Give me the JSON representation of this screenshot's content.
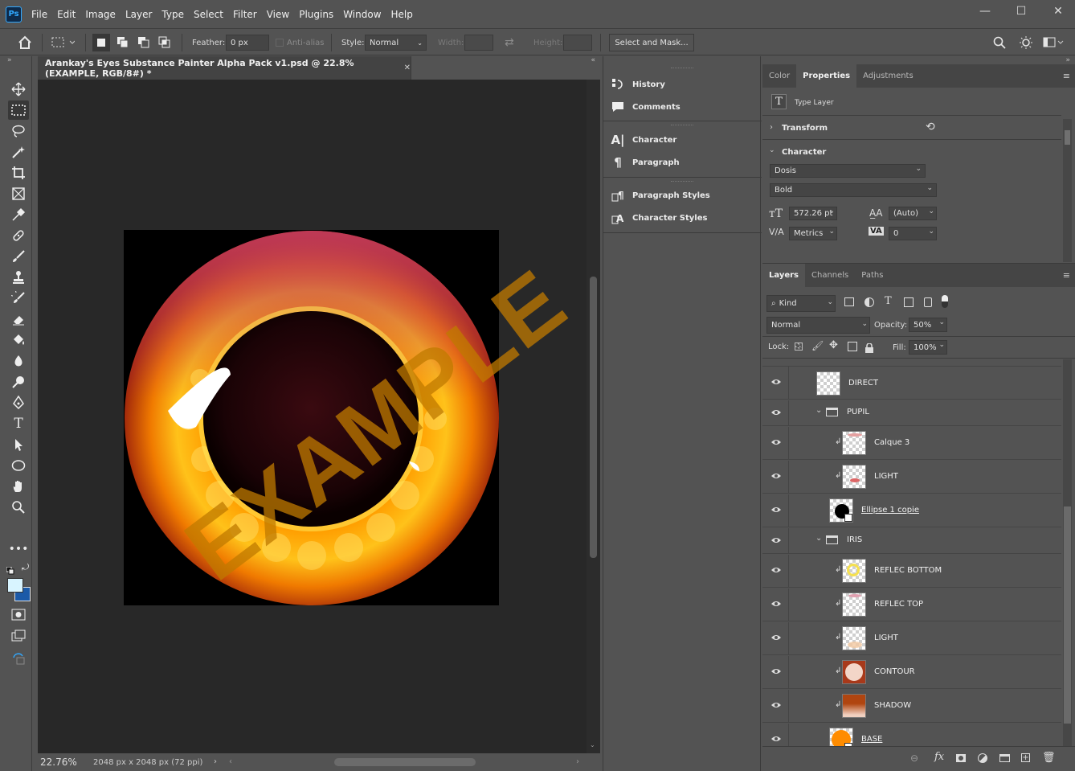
{
  "app": {
    "logo": "Ps"
  },
  "menu": [
    "File",
    "Edit",
    "Image",
    "Layer",
    "Type",
    "Select",
    "Filter",
    "View",
    "Plugins",
    "Window",
    "Help"
  ],
  "window_controls": {
    "minimize": "—",
    "maximize": "☐",
    "close": "✕"
  },
  "options": {
    "feather_label": "Feather:",
    "feather_value": "0 px",
    "antialias_label": "Anti-alias",
    "style_label": "Style:",
    "style_value": "Normal",
    "width_label": "Width:",
    "height_label": "Height:",
    "select_mask": "Select and Mask..."
  },
  "document": {
    "tab_title": "Arankay's Eyes Substance Painter Alpha Pack v1.psd @ 22.8% (EXAMPLE, RGB/8#) *",
    "watermark": "EXAMPLE",
    "zoom": "22.76%",
    "dimensions": "2048 px x 2048 px (72 ppi)"
  },
  "mid_panel": {
    "group1": [
      "History",
      "Comments"
    ],
    "group2": [
      "Character",
      "Paragraph"
    ],
    "group3": [
      "Paragraph Styles",
      "Character Styles"
    ]
  },
  "properties": {
    "tabs": [
      "Color",
      "Properties",
      "Adjustments"
    ],
    "active_tab": "Properties",
    "layer_type": "Type Layer",
    "transform_label": "Transform",
    "character_label": "Character",
    "font_family": "Dosis",
    "font_style": "Bold",
    "font_size": "572.26 pt",
    "leading": "(Auto)",
    "kerning": "Metrics",
    "tracking": "0"
  },
  "layers_panel": {
    "tabs": [
      "Layers",
      "Channels",
      "Paths"
    ],
    "filter_kind": "Kind",
    "blend_mode": "Normal",
    "opacity_label": "Opacity:",
    "opacity": "50%",
    "lock_label": "Lock:",
    "fill_label": "Fill:",
    "fill": "100%",
    "layers": [
      {
        "name": "DIRECT",
        "kind": "layer"
      },
      {
        "name": "PUPIL",
        "kind": "group"
      },
      {
        "name": "Calque 3",
        "kind": "clip"
      },
      {
        "name": "LIGHT",
        "kind": "clip"
      },
      {
        "name": "Ellipse 1 copie",
        "kind": "shape"
      },
      {
        "name": "IRIS",
        "kind": "group"
      },
      {
        "name": "REFLEC BOTTOM",
        "kind": "clip"
      },
      {
        "name": "REFLEC TOP",
        "kind": "clip"
      },
      {
        "name": "LIGHT",
        "kind": "clip"
      },
      {
        "name": "CONTOUR",
        "kind": "clip"
      },
      {
        "name": "SHADOW",
        "kind": "clip"
      },
      {
        "name": "BASE",
        "kind": "shape"
      }
    ]
  },
  "colors": {
    "accent": "#31a8ff",
    "ui_bg": "#535353",
    "canvas_bg": "#282828",
    "fg_swatch": "#d8f4ff",
    "bg_swatch": "#1b5aa8"
  }
}
